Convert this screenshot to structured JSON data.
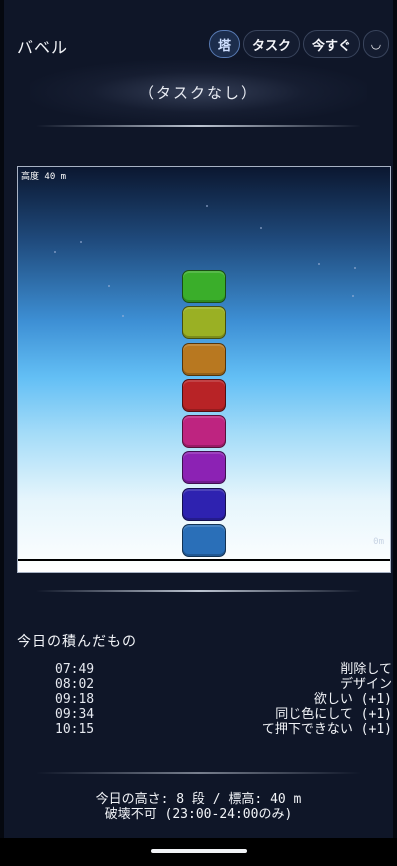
{
  "header": {
    "app_title": "バベル",
    "tabs": [
      {
        "label": "塔",
        "active": true
      },
      {
        "label": "タスク",
        "active": false
      },
      {
        "label": "今すぐ",
        "active": false
      },
      {
        "label": "◡",
        "icon": "refresh-icon"
      }
    ]
  },
  "current_task": "（タスクなし）",
  "tower": {
    "altitude_label": "高度 40 m",
    "ground_label": "0m",
    "block_count": 8,
    "blocks_bottom_to_top": [
      {
        "color": "#2a6fb8"
      },
      {
        "color": "#2e22b0"
      },
      {
        "color": "#8c22b4"
      },
      {
        "color": "#be2480"
      },
      {
        "color": "#b82326"
      },
      {
        "color": "#b87820"
      },
      {
        "color": "#9ab024"
      },
      {
        "color": "#3aae2a"
      }
    ]
  },
  "history": {
    "title": "今日の積んだもの",
    "items": [
      {
        "time": "07:49",
        "task": "削除して"
      },
      {
        "time": "08:02",
        "task": "デザイン"
      },
      {
        "time": "09:18",
        "task": "欲しい (+1)"
      },
      {
        "time": "09:34",
        "task": "同じ色にして (+1)"
      },
      {
        "time": "10:15",
        "task": "て押下できない (+1)"
      }
    ]
  },
  "footer": {
    "summary": "今日の高さ: 8 段 / 標高: 40 m",
    "notice": "破壊不可 (23:00-24:00のみ)"
  },
  "colors": {
    "background": "#0f1628",
    "active_tab": "#1c2d4c"
  }
}
